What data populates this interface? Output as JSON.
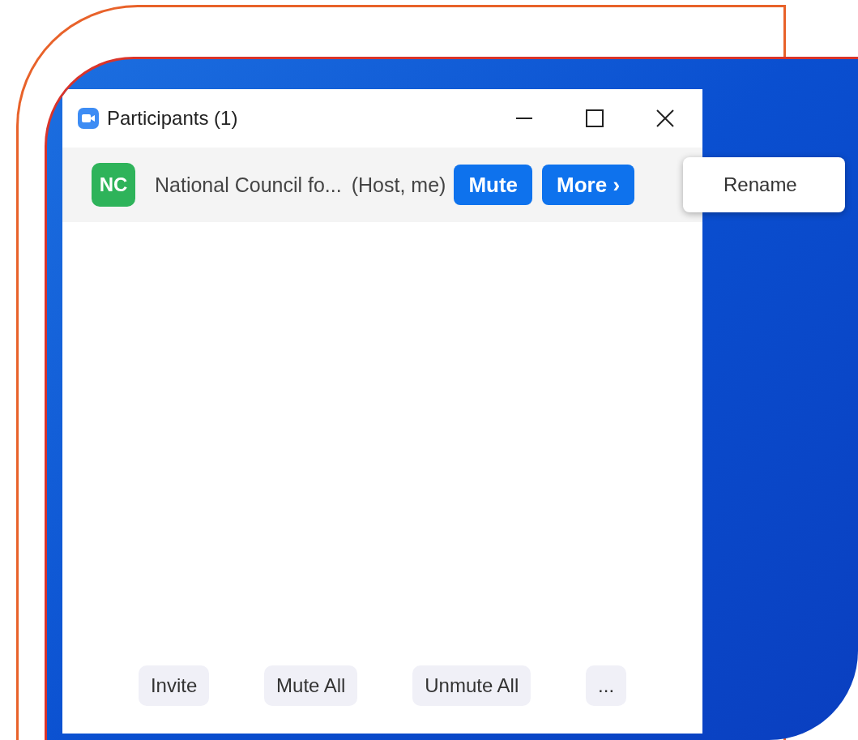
{
  "window": {
    "title": "Participants (1)"
  },
  "participants": [
    {
      "initials": "NC",
      "name": "National Council fo...",
      "role": "(Host, me)",
      "mute_button": "Mute",
      "more_button": "More ›"
    }
  ],
  "more_menu": {
    "items": [
      "Rename"
    ]
  },
  "footer_buttons": [
    "Invite",
    "Mute All",
    "Unmute All",
    "..."
  ]
}
